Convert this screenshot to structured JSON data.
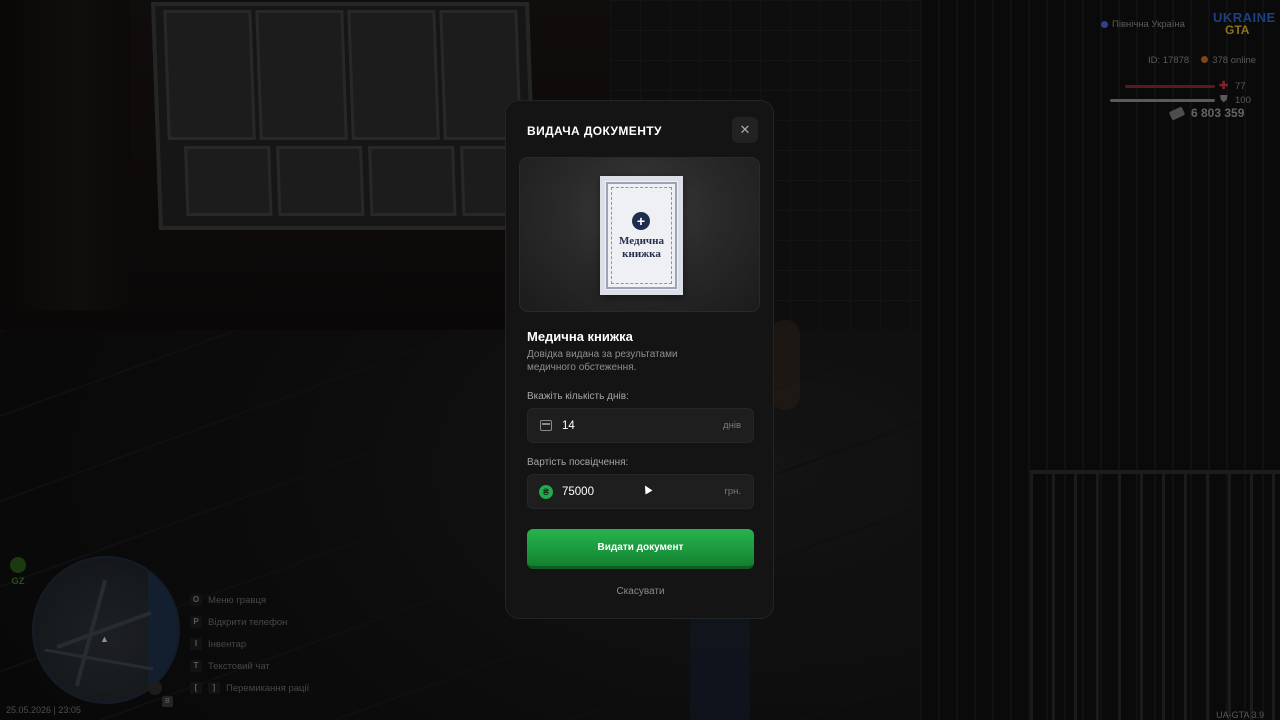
{
  "hud": {
    "region": "Північна Україна",
    "logo_top": "UKRAINE",
    "logo_bottom": "GTA",
    "player_id": "ID: 17878",
    "online": "378 online",
    "health": "77",
    "armor": "100",
    "money": "6 803 359",
    "zone": "GZ",
    "datetime": "25.05.2026 | 23:05",
    "version": "UA-GTA 3.9",
    "mic_key": "B",
    "keybinds": [
      {
        "key": "O",
        "label": "Меню гравця"
      },
      {
        "key": "P",
        "label": "Відкрити телефон"
      },
      {
        "key": "I",
        "label": "Інвентар"
      },
      {
        "key": "T",
        "label": "Текстовий чат"
      },
      {
        "key": "[",
        "key2": "]",
        "label": "Перемикання рації"
      }
    ]
  },
  "modal": {
    "title": "ВИДАЧА ДОКУМЕНТУ",
    "close_icon": "✕",
    "preview": {
      "doc_title_line1": "Медична",
      "doc_title_line2": "книжка",
      "plus": "+"
    },
    "doc_name": "Медична книжка",
    "doc_description": "Довідка видана за результатами медичного обстеження.",
    "days": {
      "label": "Вкажіть кількість днів:",
      "value": "14",
      "unit": "днів",
      "icon": "calendar-icon"
    },
    "price": {
      "label": "Вартість посвідчення:",
      "value": "75000",
      "unit": "грн.",
      "icon": "hryvnia-coin-icon",
      "icon_glyph": "₴"
    },
    "submit_label": "Видати документ",
    "cancel_label": "Скасувати"
  },
  "colors": {
    "accent_green": "#1c9a3f",
    "modal_bg": "#141414",
    "health_red": "#b8333f"
  }
}
